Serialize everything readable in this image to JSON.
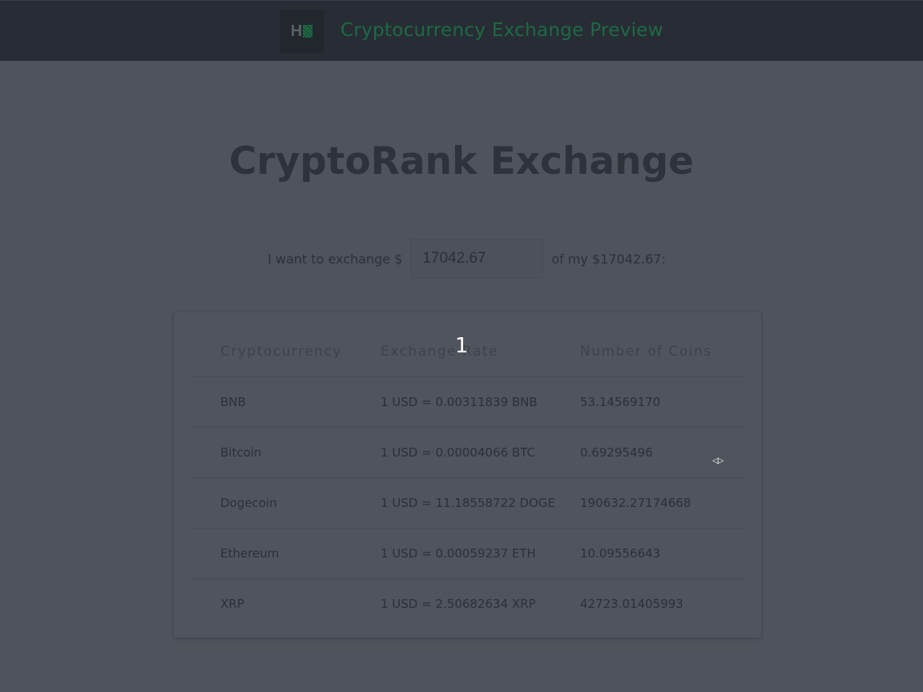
{
  "header": {
    "logo_letter": "H",
    "title": "Cryptocurrency Exchange Preview"
  },
  "main": {
    "heading": "CryptoRank Exchange",
    "exchange": {
      "prefix": "I want to exchange $",
      "amount": "17042.67",
      "suffix": "of my $17042.67:"
    },
    "table": {
      "headers": [
        "Cryptocurrency",
        "Exchange Rate",
        "Number of Coins"
      ],
      "rows": [
        {
          "name": "BNB",
          "rate": "1 USD = 0.00311839 BNB",
          "coins": "53.14569170"
        },
        {
          "name": "Bitcoin",
          "rate": "1 USD = 0.00004066 BTC",
          "coins": "0.69295496"
        },
        {
          "name": "Dogecoin",
          "rate": "1 USD = 11.18558722 DOGE",
          "coins": "190632.27174668"
        },
        {
          "name": "Ethereum",
          "rate": "1 USD = 0.00059237 ETH",
          "coins": "10.09556643"
        },
        {
          "name": "XRP",
          "rate": "1 USD = 2.50682634 XRP",
          "coins": "42723.01405993"
        }
      ]
    }
  },
  "overlay": {
    "step_marker": "1",
    "cursor_icon": "resize-horizontal-cursor"
  }
}
